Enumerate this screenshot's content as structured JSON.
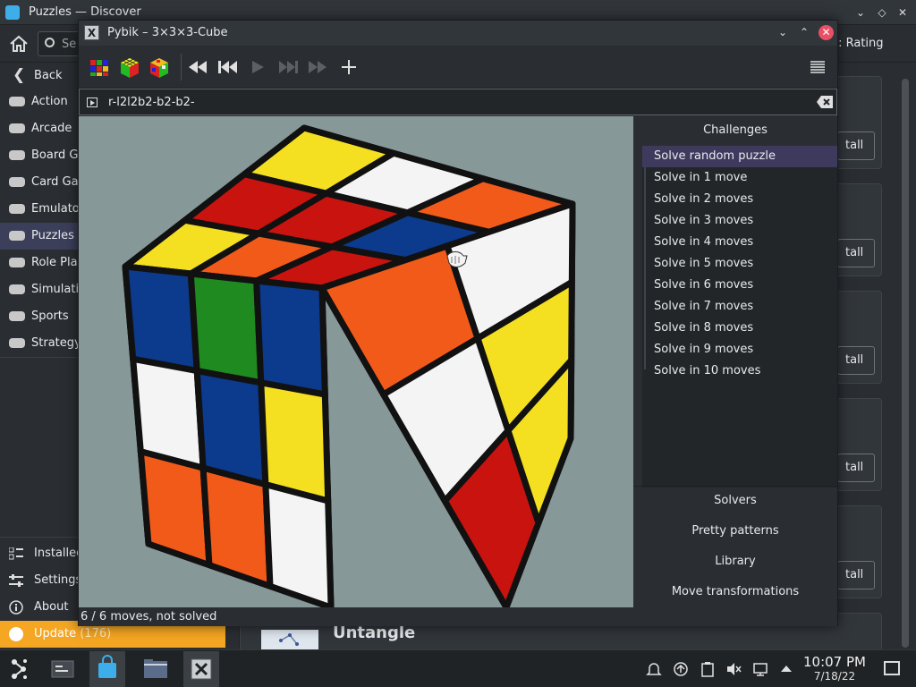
{
  "discover": {
    "title": "Puzzles — Discover",
    "search_placeholder": "Se",
    "sort_label": "t: Rating",
    "sidebar": {
      "back_label": "Back",
      "items": [
        {
          "label": "Action"
        },
        {
          "label": "Arcade"
        },
        {
          "label": "Board Ga"
        },
        {
          "label": "Card Gar"
        },
        {
          "label": "Emulato"
        },
        {
          "label": "Puzzles",
          "active": true
        },
        {
          "label": "Role Play"
        },
        {
          "label": "Simulatio"
        },
        {
          "label": "Sports"
        },
        {
          "label": "Strategy"
        }
      ],
      "bottom": {
        "installed": "Installed",
        "settings": "Settings",
        "about": "About",
        "update_label": "Update",
        "update_count": "(176)"
      }
    },
    "install_label": "tall",
    "untangle_title": "Untangle"
  },
  "pybik": {
    "title": "Pybik – 3×3×3-Cube",
    "title_icon": "X",
    "move_text": "r-l2l2b2-b2-b2-",
    "toolbar": {
      "buttons": [
        "cube-color-icon",
        "new-solved-icon",
        "random-cube-icon",
        "rewind-icon",
        "previous-icon",
        "play-icon",
        "next-icon",
        "forward-icon",
        "add-mark-icon",
        "menu-icon"
      ]
    },
    "panel": {
      "challenges_title": "Challenges",
      "challenges": [
        "Solve random puzzle",
        "Solve in 1 move",
        "Solve in 2 moves",
        "Solve in 3 moves",
        "Solve in 4 moves",
        "Solve in 5 moves",
        "Solve in 6 moves",
        "Solve in 7 moves",
        "Solve in 8 moves",
        "Solve in 9 moves",
        "Solve in 10 moves"
      ],
      "selected_index": 0,
      "solvers": "Solvers",
      "pretty_patterns": "Pretty patterns",
      "library": "Library",
      "move_transformations": "Move transformations"
    },
    "status": "6 / 6 moves, not solved",
    "cube": {
      "top": [
        [
          "yellow",
          "white",
          "orange"
        ],
        [
          "red",
          "red",
          "blue"
        ],
        [
          "yellow",
          "orange",
          "red"
        ]
      ],
      "front": [
        [
          "blue",
          "green",
          "blue"
        ],
        [
          "white",
          "blue",
          "yellow"
        ],
        [
          "orange",
          "orange",
          "white"
        ]
      ],
      "right": [
        [
          "orange",
          "white"
        ],
        [
          "white",
          "yellow"
        ],
        [
          "red",
          "yellow"
        ]
      ]
    }
  },
  "taskbar": {
    "time": "10:07 PM",
    "date": "7/18/22"
  },
  "colors": {
    "accent": "#3daee9",
    "selection": "#3e3a5e",
    "update": "#f5a623",
    "close": "#e95065",
    "viewport_bg": "#879898"
  }
}
